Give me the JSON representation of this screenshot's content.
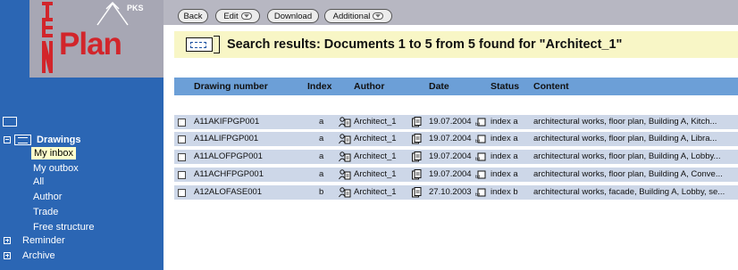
{
  "app": {
    "logo_text": "Plan",
    "logo_vertical_text": "NET",
    "logo_badge": "PKS"
  },
  "toolbar": {
    "back_label": "Back",
    "edit_label": "Edit",
    "download_label": "Download",
    "additional_label": "Additional"
  },
  "sidebar": {
    "drawings_label": "Drawings",
    "items": [
      {
        "label": "My inbox"
      },
      {
        "label": "My outbox"
      },
      {
        "label": "All"
      },
      {
        "label": "Author"
      },
      {
        "label": "Trade"
      },
      {
        "label": "Free structure"
      }
    ],
    "reminder_label": "Reminder",
    "archive_label": "Archive"
  },
  "search": {
    "title": "Search results: Documents 1 to 5 from 5 found for \"Architect_1\""
  },
  "table": {
    "headers": {
      "drawing_number": "Drawing number",
      "index": "Index",
      "author": "Author",
      "date": "Date",
      "status": "Status",
      "content": "Content"
    },
    "rows": [
      {
        "drawing_number": "A11AKIFPGP001",
        "index": "a",
        "author": "Architect_1",
        "date": "19.07.2004",
        "status": "index a",
        "content": "architectural works, floor plan, Building A, Kitch..."
      },
      {
        "drawing_number": "A11ALIFPGP001",
        "index": "a",
        "author": "Architect_1",
        "date": "19.07.2004",
        "status": "index a",
        "content": "architectural works, floor plan, Building A, Libra..."
      },
      {
        "drawing_number": "A11ALOFPGP001",
        "index": "a",
        "author": "Architect_1",
        "date": "19.07.2004",
        "status": "index a",
        "content": "architectural works, floor plan, Building A, Lobby..."
      },
      {
        "drawing_number": "A11ACHFPGP001",
        "index": "a",
        "author": "Architect_1",
        "date": "19.07.2004",
        "status": "index a",
        "content": "architectural works, floor plan, Building A, Conve..."
      },
      {
        "drawing_number": "A12ALOFASE001",
        "index": "b",
        "author": "Architect_1",
        "date": "27.10.2003",
        "status": "index b",
        "content": "architectural works, facade, Building A, Lobby, se..."
      }
    ]
  },
  "colors": {
    "sidebar_bg": "#2b66b4",
    "toolbar_bg": "#b7b7c2",
    "search_bar_bg": "#f8f6c6",
    "table_header_bg": "#6c9fd7",
    "row_bg": "#cdd7e8",
    "active_nav_bg": "#ffffcc",
    "logo_red": "#d2252b"
  }
}
